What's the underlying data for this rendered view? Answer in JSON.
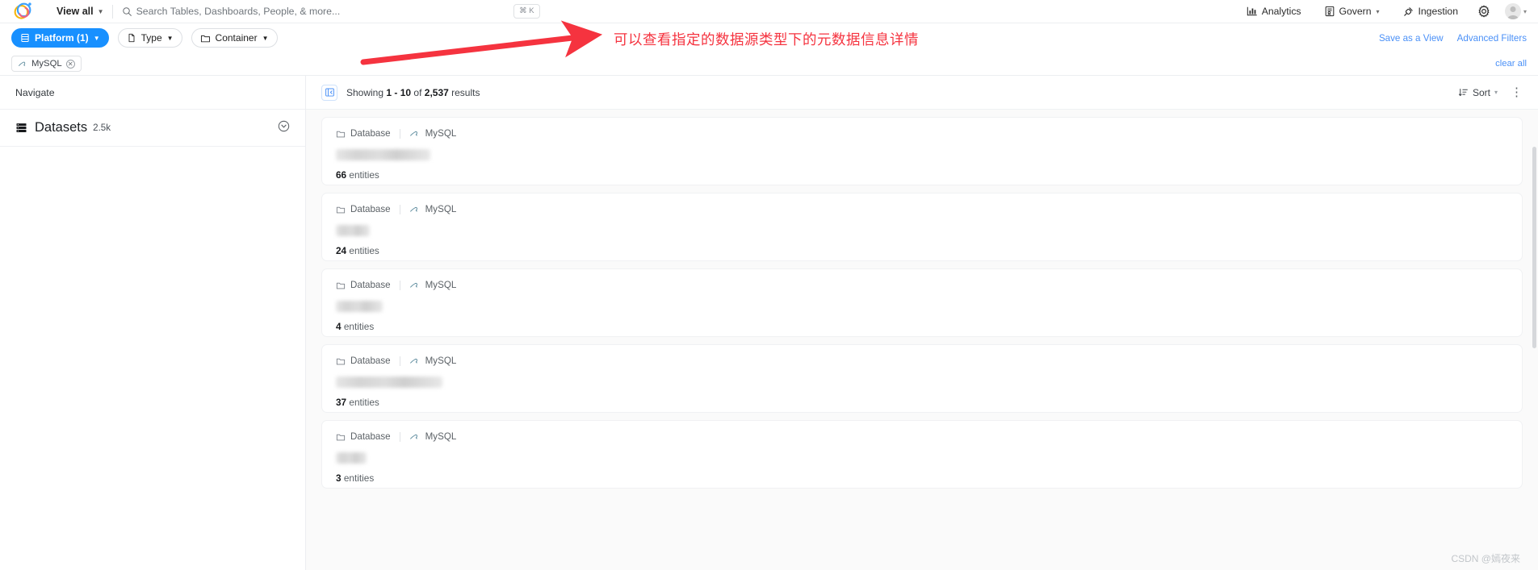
{
  "topbar": {
    "logo_name": "datahub-logo",
    "view_all": "View all",
    "view_all_caret": "▼",
    "search": {
      "placeholder": "Search Tables, Dashboards, People, & more...",
      "value": "",
      "shortcut": "⌘ K"
    },
    "nav": [
      {
        "label": "Analytics",
        "icon": "bar-chart-icon",
        "caret": ""
      },
      {
        "label": "Govern",
        "icon": "govern-icon",
        "caret": "▾"
      },
      {
        "label": "Ingestion",
        "icon": "plug-icon",
        "caret": ""
      }
    ],
    "settings_icon": "gear-icon",
    "avatar_caret": "▾"
  },
  "filters": {
    "pills": [
      {
        "label": "Platform (1)",
        "icon": "database-icon",
        "caret": "▼",
        "active": true
      },
      {
        "label": "Type",
        "icon": "file-icon",
        "caret": "▼",
        "active": false
      },
      {
        "label": "Container",
        "icon": "folder-icon",
        "caret": "▼",
        "active": false
      }
    ],
    "save_as_view": "Save as a View",
    "advanced_filters": "Advanced Filters",
    "clear_all": "clear all",
    "chips": [
      {
        "label": "MySQL",
        "icon": "mysql-icon",
        "remove": "✕"
      }
    ]
  },
  "annotation": {
    "text": "可以查看指定的数据源类型下的元数据信息详情",
    "color": "#f5333f",
    "arrow": "red-arrow"
  },
  "sidebar": {
    "title": "Navigate",
    "items": [
      {
        "label": "Datasets",
        "count": "2.5k",
        "icon": "datasets-icon",
        "chevron": "chevron-down-icon"
      }
    ]
  },
  "results": {
    "collapse_icon": "collapse-sidebar-icon",
    "showing_prefix": "Showing",
    "range": "1 - 10",
    "of": "of",
    "total": "2,537",
    "results_word": "results",
    "sort_label": "Sort",
    "sort_caret": "▾",
    "sort_icon": "sort-icon",
    "more_menu": "⋮",
    "cards": [
      {
        "type": "Database",
        "platform": "MySQL",
        "name_redacted": true,
        "name_width": 117,
        "count": "66",
        "entities_word": "entities"
      },
      {
        "type": "Database",
        "platform": "MySQL",
        "name_redacted": true,
        "name_width": 42,
        "count": "24",
        "entities_word": "entities"
      },
      {
        "type": "Database",
        "platform": "MySQL",
        "name_redacted": true,
        "name_width": 58,
        "count": "4",
        "entities_word": "entities"
      },
      {
        "type": "Database",
        "platform": "MySQL",
        "name_redacted": true,
        "name_width": 132,
        "count": "37",
        "entities_word": "entities"
      },
      {
        "type": "Database",
        "platform": "MySQL",
        "name_redacted": true,
        "name_width": 38,
        "count": "3",
        "entities_word": "entities"
      }
    ]
  },
  "watermark": "CSDN @嫣夜来"
}
